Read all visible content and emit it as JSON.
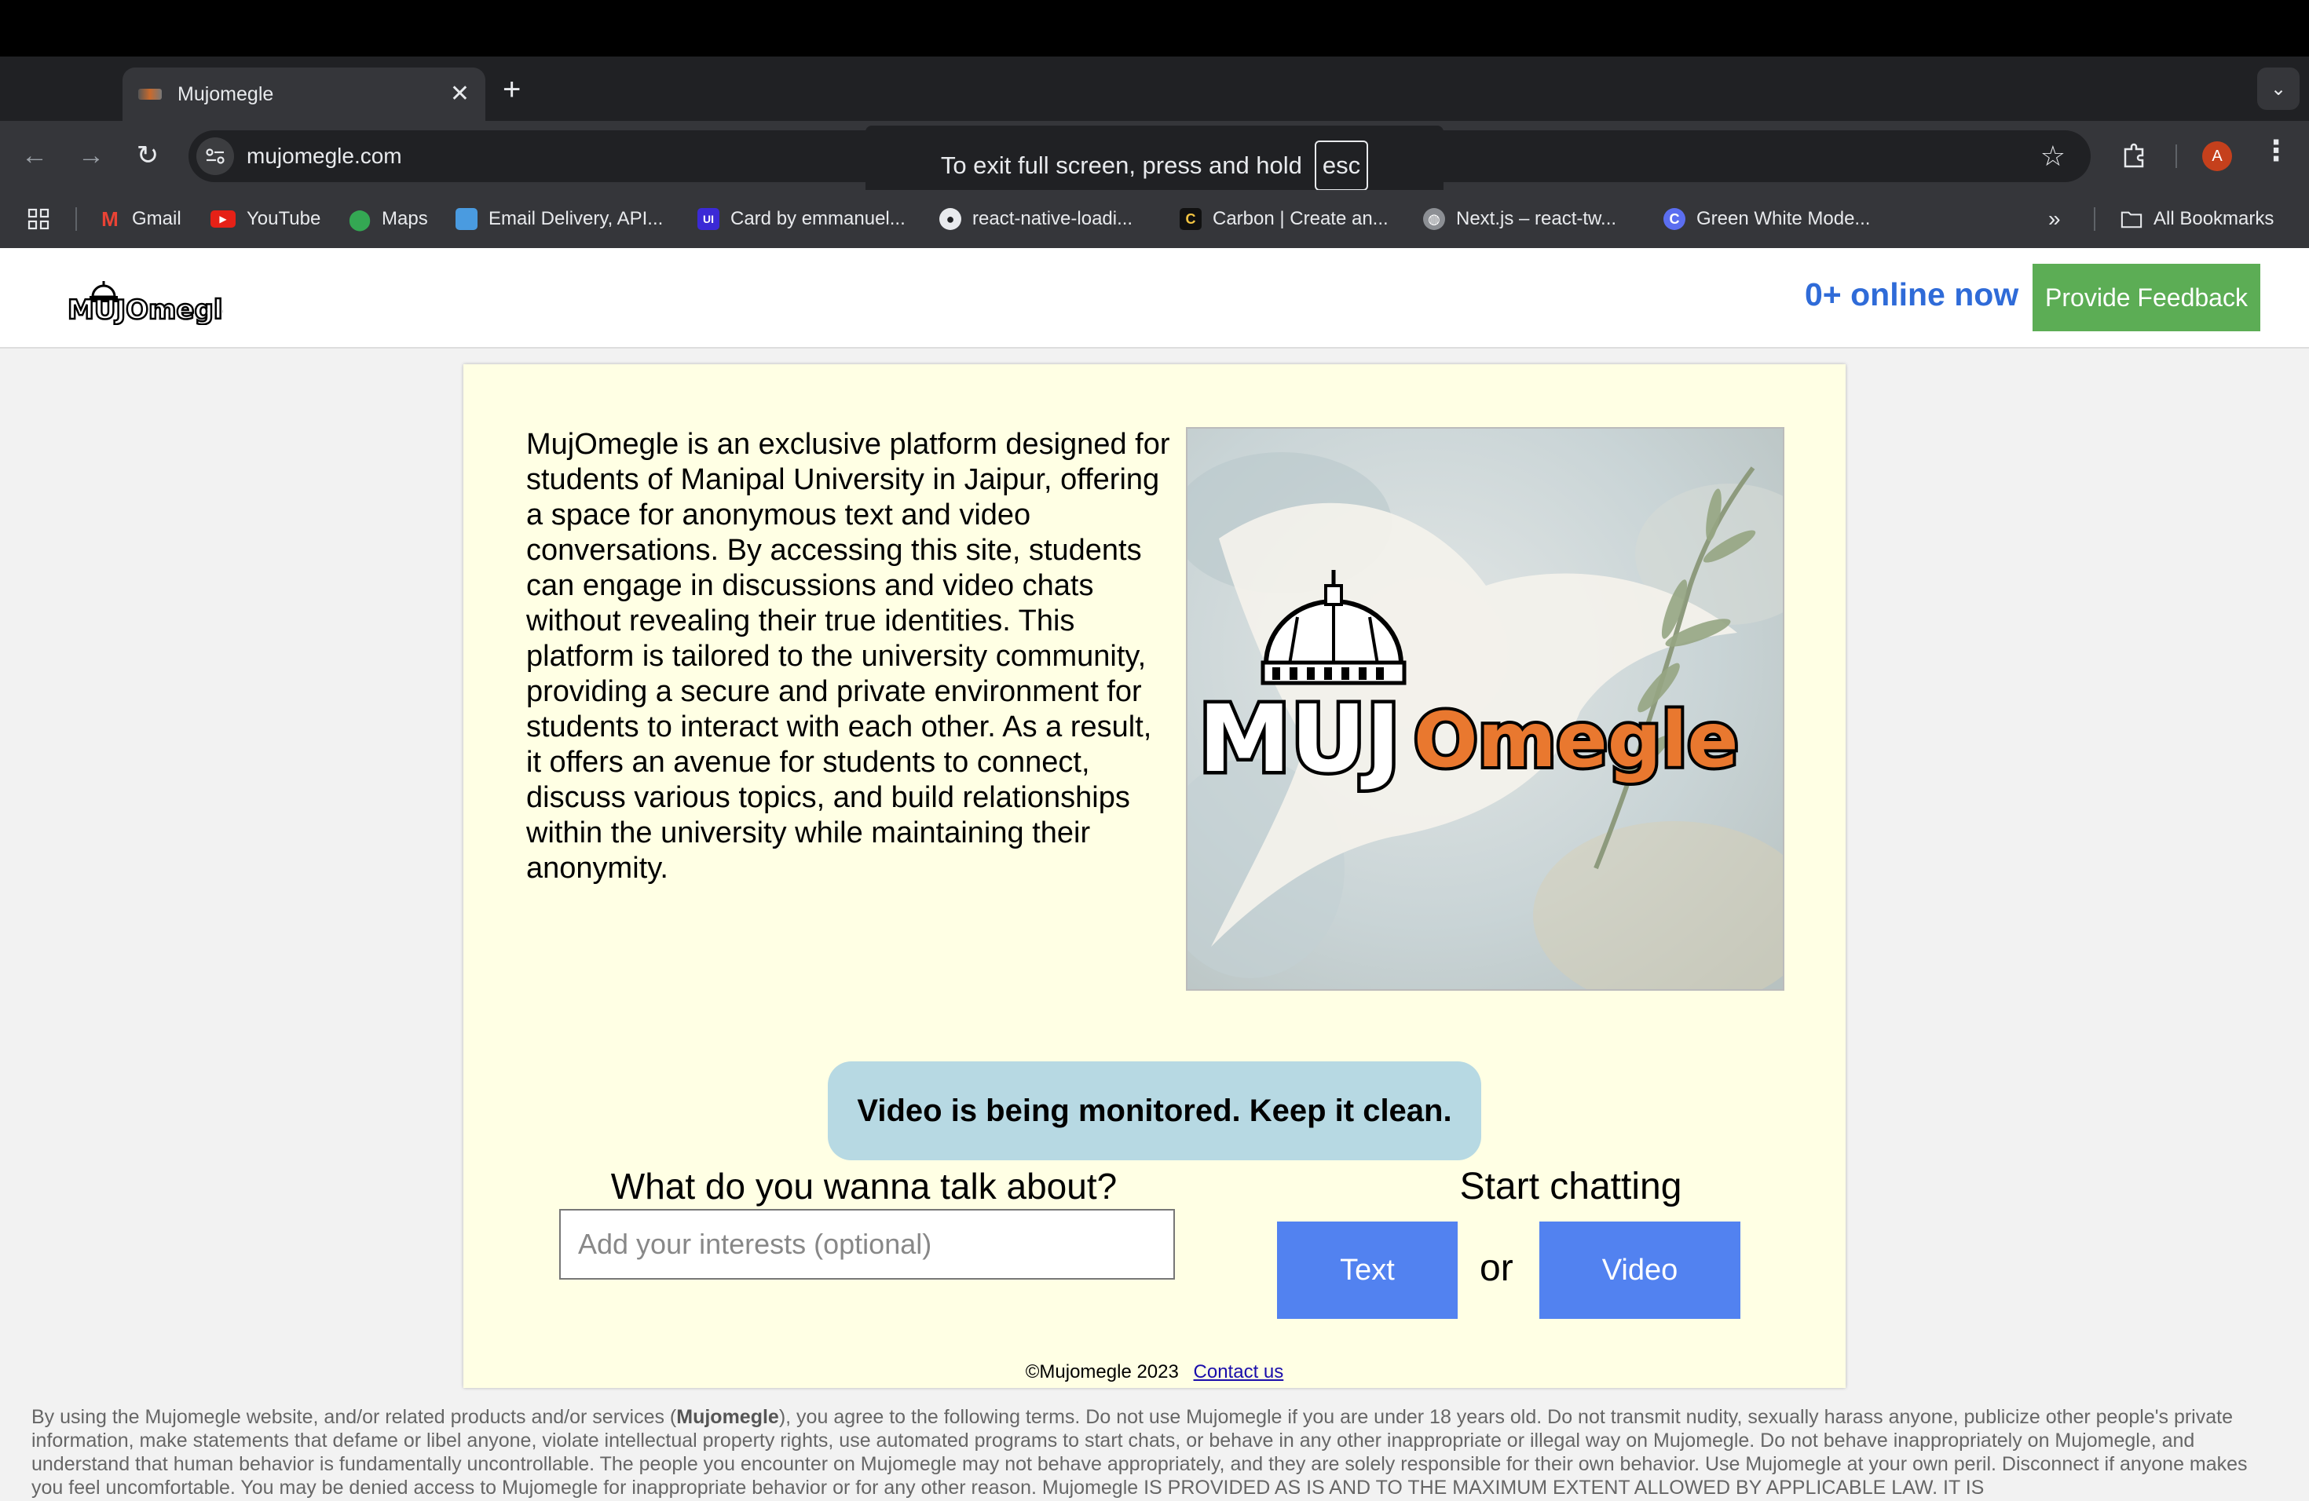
{
  "browser": {
    "tab_title": "Mujomegle",
    "url": "mujomegle.com",
    "fullscreen_toast": {
      "text": "To exit full screen, press and hold",
      "key": "esc"
    },
    "profile_initial": "A",
    "bookmarks": [
      {
        "label": "Gmail",
        "icon": "gmail-icon"
      },
      {
        "label": "YouTube",
        "icon": "youtube-icon"
      },
      {
        "label": "Maps",
        "icon": "maps-icon"
      },
      {
        "label": "Email Delivery, API...",
        "icon": "sendgrid-icon"
      },
      {
        "label": "Card by emmanuel...",
        "icon": "uiverse-icon"
      },
      {
        "label": "react-native-loadi...",
        "icon": "github-icon"
      },
      {
        "label": "Carbon | Create an...",
        "icon": "carbon-icon"
      },
      {
        "label": "Next.js – react-tw...",
        "icon": "globe-icon"
      },
      {
        "label": "Green White Mode...",
        "icon": "canva-icon"
      }
    ],
    "all_bookmarks_label": "All Bookmarks"
  },
  "header": {
    "logo_text": "MUJOmegle",
    "online_text": "0+ online now",
    "feedback_label": "Provide Feedback"
  },
  "main": {
    "about_text": "MujOmegle is an exclusive platform designed for students of Manipal University in Jaipur, offering a space for anonymous text and video conversations. By accessing this site, students can engage in discussions and video chats without revealing their true identities. This platform is tailored to the university community, providing a secure and private environment for students to interact with each other. As a result, it offers an avenue for students to connect, discuss various topics, and build relationships within the university while maintaining their anonymity.",
    "hero_logo_text_a": "MUJ",
    "hero_logo_text_b": "Omegle",
    "monitor_text": "Video is being monitored. Keep it clean.",
    "interests_label": "What do you wanna talk about?",
    "interests_placeholder": "Add your interests (optional)",
    "start_label": "Start chatting",
    "text_button": "Text",
    "or_text": "or",
    "video_button": "Video",
    "copyright": "©Mujomegle 2023",
    "contact_link": "Contact us"
  },
  "terms": {
    "prefix": "By using the Mujomegle website, and/or related products and/or services (",
    "brand": "Mujomegle",
    "body": "), you agree to the following terms. Do not use Mujomegle if you are under 18 years old. Do not transmit nudity, sexually harass anyone, publicize other people's private information, make statements that defame or libel anyone, violate intellectual property rights, use automated programs to start chats, or behave in any other inappropriate or illegal way on Mujomegle. Do not behave inappropriately on Mujomegle, and understand that human behavior is fundamentally uncontrollable. The people you encounter on Mujomegle may not behave appropriately, and they are solely responsible for their own behavior. Use Mujomegle at your own peril. Disconnect if anyone makes you feel uncomfortable. You may be denied access to Mujomegle for inappropriate behavior or for any other reason. Mujomegle IS PROVIDED AS IS AND TO THE MAXIMUM EXTENT ALLOWED BY APPLICABLE LAW. IT IS"
  },
  "colors": {
    "accent_blue": "#2f6bd8",
    "button_blue": "#5282f0",
    "feedback_green": "#5cad55",
    "card_bg": "#ffffe4",
    "monitor_bg": "#b7d9e3",
    "logo_orange": "#e9782f"
  }
}
